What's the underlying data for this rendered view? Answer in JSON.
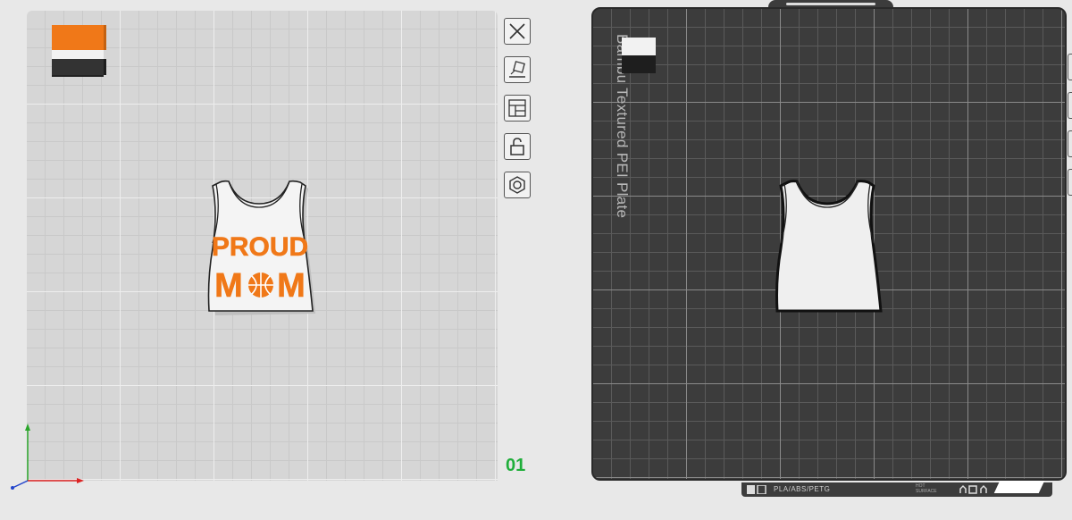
{
  "plate1": {
    "number": "01",
    "jersey_text_line1": "PROUD",
    "jersey_text_line2_left": "M",
    "jersey_text_line2_right": "M",
    "toolbar": [
      {
        "name": "close-icon"
      },
      {
        "name": "auto-orient-icon"
      },
      {
        "name": "arrange-icon"
      },
      {
        "name": "lock-icon"
      },
      {
        "name": "settings-icon"
      }
    ]
  },
  "plate2": {
    "label": "Bambu Textured PEI Plate",
    "filament": "PLA/ABS/PETG",
    "surface": "HOT SURFACE"
  },
  "colors": {
    "orange": "#f07818",
    "white": "#f2f2f2",
    "black": "#333333",
    "plate_number": "#1fae3a",
    "dark_plate": "#3c3c3c"
  }
}
